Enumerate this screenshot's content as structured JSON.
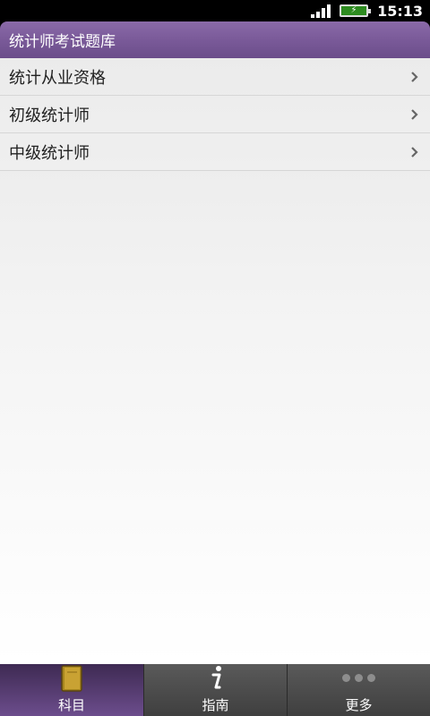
{
  "status_bar": {
    "time": "15:13"
  },
  "header": {
    "title": "统计师考试题库"
  },
  "list": {
    "items": [
      {
        "label": "统计从业资格"
      },
      {
        "label": "初级统计师"
      },
      {
        "label": "中级统计师"
      }
    ]
  },
  "tabs": [
    {
      "label": "科目",
      "icon": "book-icon",
      "active": true
    },
    {
      "label": "指南",
      "icon": "info-icon",
      "active": false
    },
    {
      "label": "更多",
      "icon": "more-dots-icon",
      "active": false
    }
  ],
  "colors": {
    "accent": "#7a5a99",
    "tab_bar": "#4a4a4a"
  }
}
